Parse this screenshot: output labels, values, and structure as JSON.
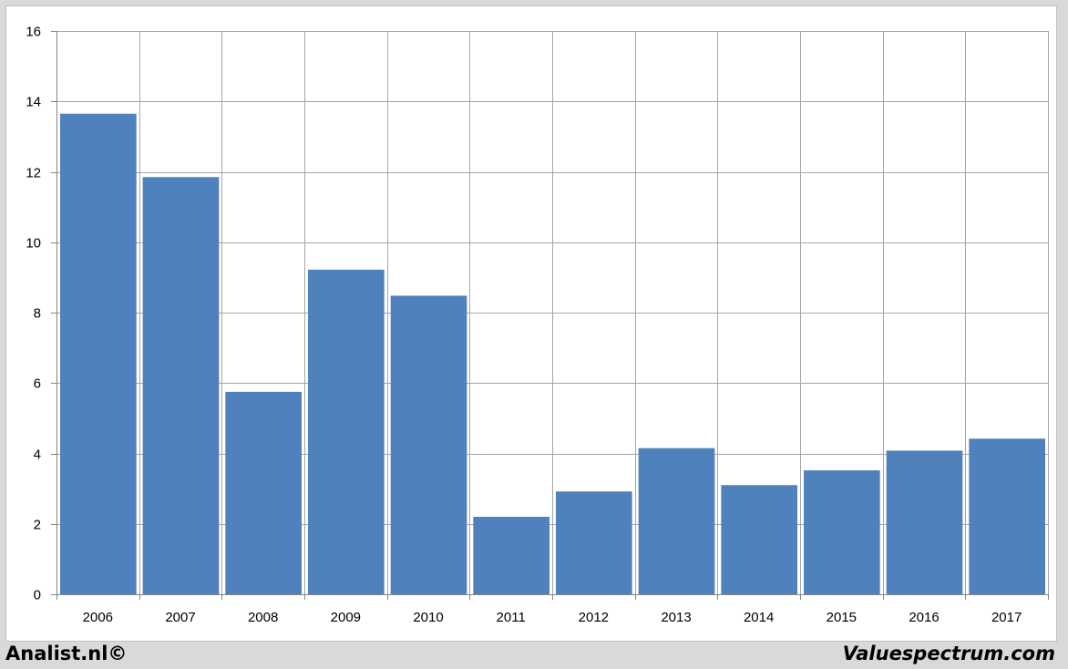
{
  "footer": {
    "left_text": "Analist.nl©",
    "right_text": "Valuespectrum.com"
  },
  "chart_data": {
    "type": "bar",
    "categories": [
      "2006",
      "2007",
      "2008",
      "2009",
      "2010",
      "2011",
      "2012",
      "2013",
      "2014",
      "2015",
      "2016",
      "2017"
    ],
    "values": [
      13.65,
      11.85,
      5.75,
      9.22,
      8.48,
      2.2,
      2.92,
      4.15,
      3.1,
      3.52,
      4.08,
      4.42
    ],
    "ylim": [
      0,
      16
    ],
    "yticks": [
      0,
      2,
      4,
      6,
      8,
      10,
      12,
      14,
      16
    ],
    "grid": true,
    "title": "",
    "xlabel": "",
    "ylabel": "",
    "colors": {
      "bar": "#4f81bd",
      "grid": "#a6a6a6",
      "axis": "#868686"
    }
  }
}
